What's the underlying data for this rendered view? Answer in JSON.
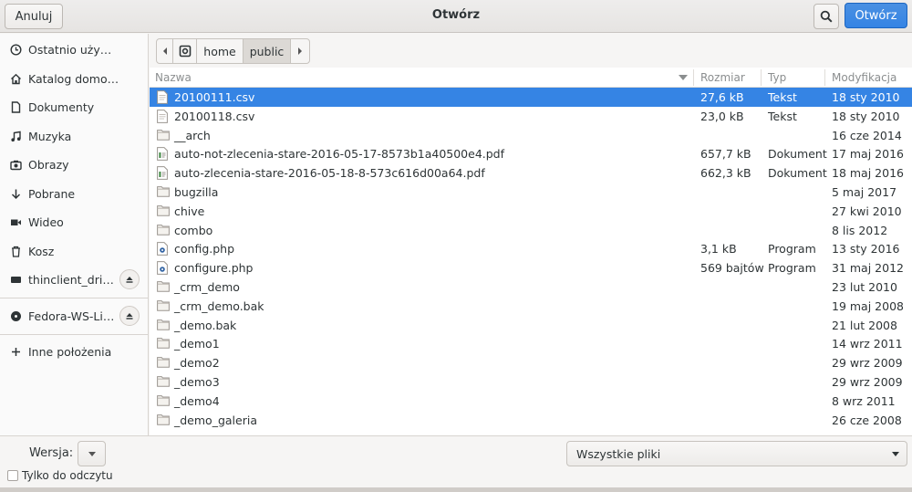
{
  "header": {
    "title": "Otwórz",
    "cancel_label": "Anuluj",
    "open_label": "Otwórz"
  },
  "sidebar": {
    "items": [
      {
        "label": "Ostatnio używane",
        "icon": "clock-icon"
      },
      {
        "label": "Katalog domowy",
        "icon": "home-icon"
      },
      {
        "label": "Dokumenty",
        "icon": "document-icon"
      },
      {
        "label": "Muzyka",
        "icon": "music-icon"
      },
      {
        "label": "Obrazy",
        "icon": "camera-icon"
      },
      {
        "label": "Pobrane",
        "icon": "download-icon"
      },
      {
        "label": "Wideo",
        "icon": "video-icon"
      },
      {
        "label": "Kosz",
        "icon": "trash-icon"
      },
      {
        "label": "thinclient_drives",
        "icon": "drive-icon"
      },
      {
        "label": "Fedora-WS-Liv…",
        "icon": "disc-icon"
      },
      {
        "label": "Inne położenia",
        "icon": "plus-icon"
      }
    ]
  },
  "pathbar": {
    "segments": [
      "home",
      "public"
    ]
  },
  "columns": {
    "name": "Nazwa",
    "size": "Rozmiar",
    "type": "Typ",
    "modified": "Modyfikacja"
  },
  "files": [
    {
      "name": "20100111.csv",
      "size": "27,6 kB",
      "type": "Tekst",
      "date": "18 sty 2010",
      "kind": "text",
      "selected": true
    },
    {
      "name": "20100118.csv",
      "size": "23,0 kB",
      "type": "Tekst",
      "date": "18 sty 2010",
      "kind": "text"
    },
    {
      "name": "__arch",
      "size": "",
      "type": "",
      "date": "16 cze 2014",
      "kind": "folder"
    },
    {
      "name": "auto-not-zlecenia-stare-2016-05-17-8573b1a40500e4.pdf",
      "size": "657,7 kB",
      "type": "Dokument",
      "date": "17 maj 2016",
      "kind": "pdf"
    },
    {
      "name": "auto-zlecenia-stare-2016-05-18-8-573c616d00a64.pdf",
      "size": "662,3 kB",
      "type": "Dokument",
      "date": "18 maj 2016",
      "kind": "pdf"
    },
    {
      "name": "bugzilla",
      "size": "",
      "type": "",
      "date": "5 maj 2017",
      "kind": "folder"
    },
    {
      "name": "chive",
      "size": "",
      "type": "",
      "date": "27 kwi 2010",
      "kind": "folder"
    },
    {
      "name": "combo",
      "size": "",
      "type": "",
      "date": "8 lis 2012",
      "kind": "folder"
    },
    {
      "name": "config.php",
      "size": "3,1 kB",
      "type": "Program",
      "date": "13 sty 2016",
      "kind": "php"
    },
    {
      "name": "configure.php",
      "size": "569 bajtów",
      "type": "Program",
      "date": "31 maj 2012",
      "kind": "php"
    },
    {
      "name": "_crm_demo",
      "size": "",
      "type": "",
      "date": "23 lut 2010",
      "kind": "folder"
    },
    {
      "name": "_crm_demo.bak",
      "size": "",
      "type": "",
      "date": "19 maj 2008",
      "kind": "folder"
    },
    {
      "name": "_demo.bak",
      "size": "",
      "type": "",
      "date": "21 lut 2008",
      "kind": "folder"
    },
    {
      "name": "_demo1",
      "size": "",
      "type": "",
      "date": "14 wrz 2011",
      "kind": "folder"
    },
    {
      "name": "_demo2",
      "size": "",
      "type": "",
      "date": "29 wrz 2009",
      "kind": "folder"
    },
    {
      "name": "_demo3",
      "size": "",
      "type": "",
      "date": "29 wrz 2009",
      "kind": "folder"
    },
    {
      "name": "_demo4",
      "size": "",
      "type": "",
      "date": "8 wrz 2011",
      "kind": "folder"
    },
    {
      "name": "_demo_galeria",
      "size": "",
      "type": "",
      "date": "26 cze 2008",
      "kind": "folder"
    }
  ],
  "footer": {
    "version_label": "Wersja:",
    "filter_value": "Wszystkie pliki",
    "readonly_label": "Tylko do odczytu"
  }
}
